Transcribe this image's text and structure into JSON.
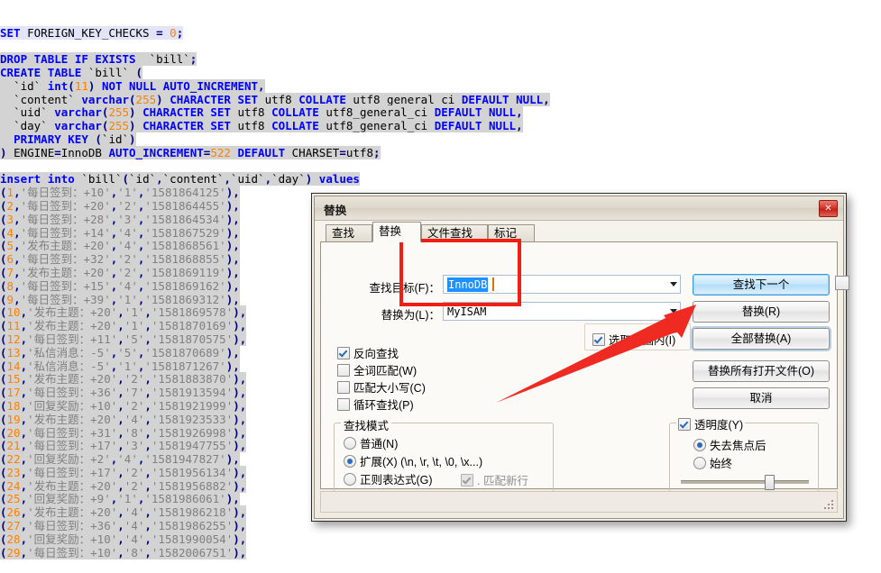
{
  "editor": {
    "sql_lines": [
      {
        "t": "SET FOREIGN_KEY_CHECKS = 0;",
        "style": "stmt0",
        "cur": true
      },
      {
        "t": "",
        "style": "blank"
      },
      {
        "t": "DROP TABLE IF EXISTS  `bill`;",
        "style": "stmt1"
      },
      {
        "t": "CREATE TABLE `bill` (",
        "style": "stmt2"
      },
      {
        "t": "  `id` int(11) NOT NULL AUTO_INCREMENT,",
        "style": "stmt3"
      },
      {
        "t": "  `content` varchar(255) CHARACTER SET utf8 COLLATE utf8_general_ci DEFAULT NULL,",
        "style": "stmt4"
      },
      {
        "t": "  `uid` varchar(255) CHARACTER SET utf8 COLLATE utf8_general_ci DEFAULT NULL,",
        "style": "stmt5"
      },
      {
        "t": "  `day` varchar(255) CHARACTER SET utf8 COLLATE utf8_general_ci DEFAULT NULL,",
        "style": "stmt6"
      },
      {
        "t": "  PRIMARY KEY (`id`)",
        "style": "stmt7"
      },
      {
        "t": ") ENGINE=InnoDB AUTO_INCREMENT=522 DEFAULT CHARSET=utf8;",
        "style": "stmt8"
      },
      {
        "t": "",
        "style": "blank"
      },
      {
        "t": "insert into `bill`(`id`,`content`,`uid`,`day`) values",
        "style": "insert"
      }
    ],
    "values_rows": [
      {
        "id": "1",
        "content": "每日签到：+10",
        "uid": "1",
        "day": "1581864125"
      },
      {
        "id": "2",
        "content": "每日签到：+20",
        "uid": "2",
        "day": "1581864455"
      },
      {
        "id": "3",
        "content": "每日签到：+28",
        "uid": "3",
        "day": "1581864534"
      },
      {
        "id": "4",
        "content": "每日签到：+14",
        "uid": "4",
        "day": "1581867529"
      },
      {
        "id": "5",
        "content": "发布主题：+20",
        "uid": "4",
        "day": "1581868561"
      },
      {
        "id": "6",
        "content": "每日签到：+32",
        "uid": "2",
        "day": "1581868855"
      },
      {
        "id": "7",
        "content": "发布主题：+20",
        "uid": "2",
        "day": "1581869119"
      },
      {
        "id": "8",
        "content": "每日签到：+15",
        "uid": "4",
        "day": "1581869162"
      },
      {
        "id": "9",
        "content": "每日签到：+39",
        "uid": "1",
        "day": "1581869312"
      },
      {
        "id": "10",
        "content": "发布主题：+20",
        "uid": "1",
        "day": "1581869578"
      },
      {
        "id": "11",
        "content": "发布主题：+20",
        "uid": "1",
        "day": "1581870169"
      },
      {
        "id": "12",
        "content": "每日签到：+11",
        "uid": "5",
        "day": "1581870575"
      },
      {
        "id": "13",
        "content": "私信消息：-5",
        "uid": "5",
        "day": "1581870689"
      },
      {
        "id": "14",
        "content": "私信消息：-5",
        "uid": "1",
        "day": "1581871267"
      },
      {
        "id": "15",
        "content": "发布主题：+20",
        "uid": "2",
        "day": "1581883870"
      },
      {
        "id": "17",
        "content": "每日签到：+36",
        "uid": "7",
        "day": "1581913594"
      },
      {
        "id": "18",
        "content": "回复奖励：+10",
        "uid": "2",
        "day": "1581921999"
      },
      {
        "id": "19",
        "content": "发布主题：+20",
        "uid": "4",
        "day": "1581923533"
      },
      {
        "id": "20",
        "content": "每日签到：+31",
        "uid": "8",
        "day": "1581926998"
      },
      {
        "id": "21",
        "content": "每日签到：+17",
        "uid": "3",
        "day": "1581947755"
      },
      {
        "id": "22",
        "content": "回复奖励：+2",
        "uid": "4",
        "day": "1581947827"
      },
      {
        "id": "23",
        "content": "每日签到：+17",
        "uid": "2",
        "day": "1581956134"
      },
      {
        "id": "24",
        "content": "发布主题：+20",
        "uid": "2",
        "day": "1581956882"
      },
      {
        "id": "25",
        "content": "回复奖励：+9",
        "uid": "1",
        "day": "1581986061"
      },
      {
        "id": "26",
        "content": "发布主题：+20",
        "uid": "4",
        "day": "1581986218"
      },
      {
        "id": "27",
        "content": "每日签到：+36",
        "uid": "4",
        "day": "1581986255"
      },
      {
        "id": "28",
        "content": "回复奖励：+10",
        "uid": "4",
        "day": "1581990054"
      },
      {
        "id": "29",
        "content": "每日签到：+10",
        "uid": "8",
        "day": "1582006751"
      }
    ]
  },
  "dialog": {
    "title": "替换",
    "close_label": "✕",
    "tabs": [
      {
        "label": "查找",
        "active": false
      },
      {
        "label": "替换",
        "active": true
      },
      {
        "label": "文件查找",
        "active": false
      },
      {
        "label": "标记",
        "active": false
      }
    ],
    "fields": {
      "find_label": "查找目标(F)：",
      "find_value": "InnoDB",
      "replace_label": "替换为(L)：",
      "replace_value": "MyISAM"
    },
    "buttons": {
      "find_next": "查找下一个",
      "replace": "替换(R)",
      "replace_all": "全部替换(A)",
      "replace_all_open": "替换所有打开文件(O)",
      "cancel": "取消"
    },
    "scope": {
      "label": "选取范围内(I)",
      "checked": true
    },
    "options": [
      {
        "label": "反向查找",
        "checked": true,
        "accel": ""
      },
      {
        "label": "全词匹配(W)",
        "checked": false
      },
      {
        "label": "匹配大小写(C)",
        "checked": false
      },
      {
        "label": "循环查找(P)",
        "checked": false
      }
    ],
    "search_mode": {
      "legend": "查找模式",
      "items": [
        {
          "label": "普通(N)",
          "selected": false
        },
        {
          "label": "扩展(X) (\\n, \\r, \\t, \\0, \\x...)",
          "selected": true
        },
        {
          "label": "正则表达式(G)",
          "selected": false
        }
      ],
      "dot_matches_newline": {
        "label": ". 匹配新行",
        "checked": true,
        "disabled": true
      }
    },
    "transparency": {
      "label": "透明度(Y)",
      "checked": true,
      "items": [
        {
          "label": "失去焦点后",
          "selected": true
        },
        {
          "label": "始终",
          "selected": false
        }
      ],
      "slider_percent": 70
    }
  },
  "annotations": {
    "highlight_box_color": "#f01e14",
    "arrow_color": "#ee2a22",
    "arrow_points_to": "全部替换(A)"
  },
  "colors": {
    "keyword": "#0000ff",
    "number": "#ff8000",
    "string": "#808080",
    "punct": "#000080",
    "selection": "#d3d3d3",
    "current_line": "#e6e6fa",
    "dialog_bg": "#f0ece4",
    "default_button": "#b2dcf8"
  }
}
